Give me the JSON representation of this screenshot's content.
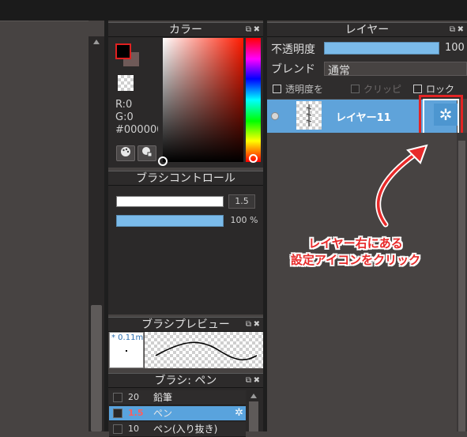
{
  "color_panel": {
    "title": "カラー",
    "r_label": "R:0",
    "g_label": "G:0",
    "hex_label": "#000000",
    "palette_icon": "palette-icon",
    "palette2_icon": "palette-swap-icon"
  },
  "brush_control": {
    "title": "ブラシコントロール",
    "size_value": "1.5",
    "opacity_value": "100 %"
  },
  "brush_preview": {
    "title": "ブラシプレビュー",
    "size_label": "* 0.11m"
  },
  "brush_list": {
    "title": "ブラシ: ペン",
    "items": [
      {
        "size": "20",
        "name": "鉛筆"
      },
      {
        "size": "1.5",
        "name": "ペン"
      },
      {
        "size": "10",
        "name": "ペン(入り抜き)"
      }
    ]
  },
  "layer_panel": {
    "title": "レイヤー",
    "opacity_label": "不透明度",
    "opacity_value": "100",
    "opacity_fraction": 0.95,
    "blend_label": "ブレンド",
    "blend_value": "通常",
    "lock_alpha_label": "透明度を",
    "clip_label": "クリッピ",
    "lock_label": "ロック",
    "layer_name": "レイヤー11",
    "gear_icon": "gear-icon"
  },
  "annotation": {
    "line1": "レイヤー右にある",
    "line2": "設定アイコンをクリック"
  },
  "colors": {
    "accent": "#5fa3da",
    "highlight_red": "#e32424"
  }
}
